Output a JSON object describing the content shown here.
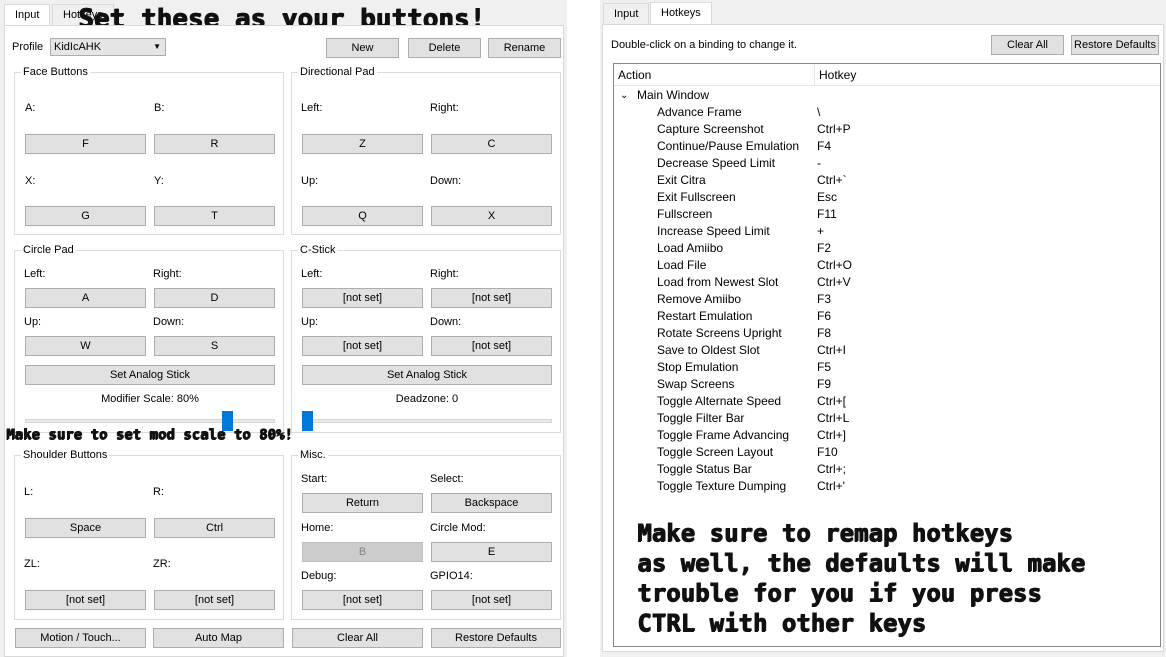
{
  "left": {
    "tabs": [
      "Input",
      "Hotkeys"
    ],
    "overlay_top": "Set these as your buttons!",
    "overlay_mid": "Make sure to set mod scale to 80%!",
    "profile_label": "Profile",
    "profile_value": "KidIcAHK",
    "buttons": {
      "new": "New",
      "delete": "Delete",
      "rename": "Rename"
    },
    "face": {
      "title": "Face Buttons",
      "a_label": "A:",
      "a_value": "F",
      "b_label": "B:",
      "b_value": "R",
      "x_label": "X:",
      "x_value": "G",
      "y_label": "Y:",
      "y_value": "T"
    },
    "dpad": {
      "title": "Directional Pad",
      "left_label": "Left:",
      "left_value": "Z",
      "right_label": "Right:",
      "right_value": "C",
      "up_label": "Up:",
      "up_value": "Q",
      "down_label": "Down:",
      "down_value": "X"
    },
    "circle": {
      "title": "Circle Pad",
      "left_label": "Left:",
      "left_value": "A",
      "right_label": "Right:",
      "right_value": "D",
      "up_label": "Up:",
      "up_value": "W",
      "down_label": "Down:",
      "down_value": "S",
      "analog": "Set Analog Stick",
      "modifier": "Modifier Scale: 80%",
      "modifier_level": 0.8
    },
    "cstick": {
      "title": "C-Stick",
      "left_label": "Left:",
      "left_value": "[not set]",
      "right_label": "Right:",
      "right_value": "[not set]",
      "up_label": "Up:",
      "up_value": "[not set]",
      "down_label": "Down:",
      "down_value": "[not set]",
      "analog": "Set Analog Stick",
      "deadzone": "Deadzone: 0",
      "deadzone_level": 0
    },
    "shoulder": {
      "title": "Shoulder Buttons",
      "l_label": "L:",
      "l_value": "Space",
      "r_label": "R:",
      "r_value": "Ctrl",
      "zl_label": "ZL:",
      "zl_value": "[not set]",
      "zr_label": "ZR:",
      "zr_value": "[not set]"
    },
    "misc": {
      "title": "Misc.",
      "start_label": "Start:",
      "start_value": "Return",
      "select_label": "Select:",
      "select_value": "Backspace",
      "home_label": "Home:",
      "home_value": "B",
      "circlemod_label": "Circle Mod:",
      "circlemod_value": "E",
      "debug_label": "Debug:",
      "debug_value": "[not set]",
      "gpio_label": "GPIO14:",
      "gpio_value": "[not set]"
    },
    "bottom": {
      "motion": "Motion / Touch...",
      "automap": "Auto Map",
      "clearall": "Clear All",
      "restore": "Restore Defaults"
    }
  },
  "right": {
    "tabs": [
      "Input",
      "Hotkeys"
    ],
    "hint": "Double-click on a binding to change it.",
    "clear_all": "Clear All",
    "restore": "Restore Defaults",
    "col_action": "Action",
    "col_hotkey": "Hotkey",
    "group": "Main Window",
    "rows": [
      {
        "action": "Advance Frame",
        "hotkey": "\\"
      },
      {
        "action": "Capture Screenshot",
        "hotkey": "Ctrl+P"
      },
      {
        "action": "Continue/Pause Emulation",
        "hotkey": "F4"
      },
      {
        "action": "Decrease Speed Limit",
        "hotkey": "-"
      },
      {
        "action": "Exit Citra",
        "hotkey": "Ctrl+`"
      },
      {
        "action": "Exit Fullscreen",
        "hotkey": "Esc"
      },
      {
        "action": "Fullscreen",
        "hotkey": "F11"
      },
      {
        "action": "Increase Speed Limit",
        "hotkey": "+"
      },
      {
        "action": "Load Amiibo",
        "hotkey": "F2"
      },
      {
        "action": "Load File",
        "hotkey": "Ctrl+O"
      },
      {
        "action": "Load from Newest Slot",
        "hotkey": "Ctrl+V"
      },
      {
        "action": "Remove Amiibo",
        "hotkey": "F3"
      },
      {
        "action": "Restart Emulation",
        "hotkey": "F6"
      },
      {
        "action": "Rotate Screens Upright",
        "hotkey": "F8"
      },
      {
        "action": "Save to Oldest Slot",
        "hotkey": "Ctrl+I"
      },
      {
        "action": "Stop Emulation",
        "hotkey": "F5"
      },
      {
        "action": "Swap Screens",
        "hotkey": "F9"
      },
      {
        "action": "Toggle Alternate Speed",
        "hotkey": "Ctrl+["
      },
      {
        "action": "Toggle Filter Bar",
        "hotkey": "Ctrl+L"
      },
      {
        "action": "Toggle Frame Advancing",
        "hotkey": "Ctrl+]"
      },
      {
        "action": "Toggle Screen Layout",
        "hotkey": "F10"
      },
      {
        "action": "Toggle Status Bar",
        "hotkey": "Ctrl+;"
      },
      {
        "action": "Toggle Texture Dumping",
        "hotkey": "Ctrl+'"
      }
    ],
    "overlay": [
      "Make sure to remap hotkeys",
      "as well, the defaults will make",
      "trouble for you if you press",
      "CTRL with other keys"
    ]
  }
}
